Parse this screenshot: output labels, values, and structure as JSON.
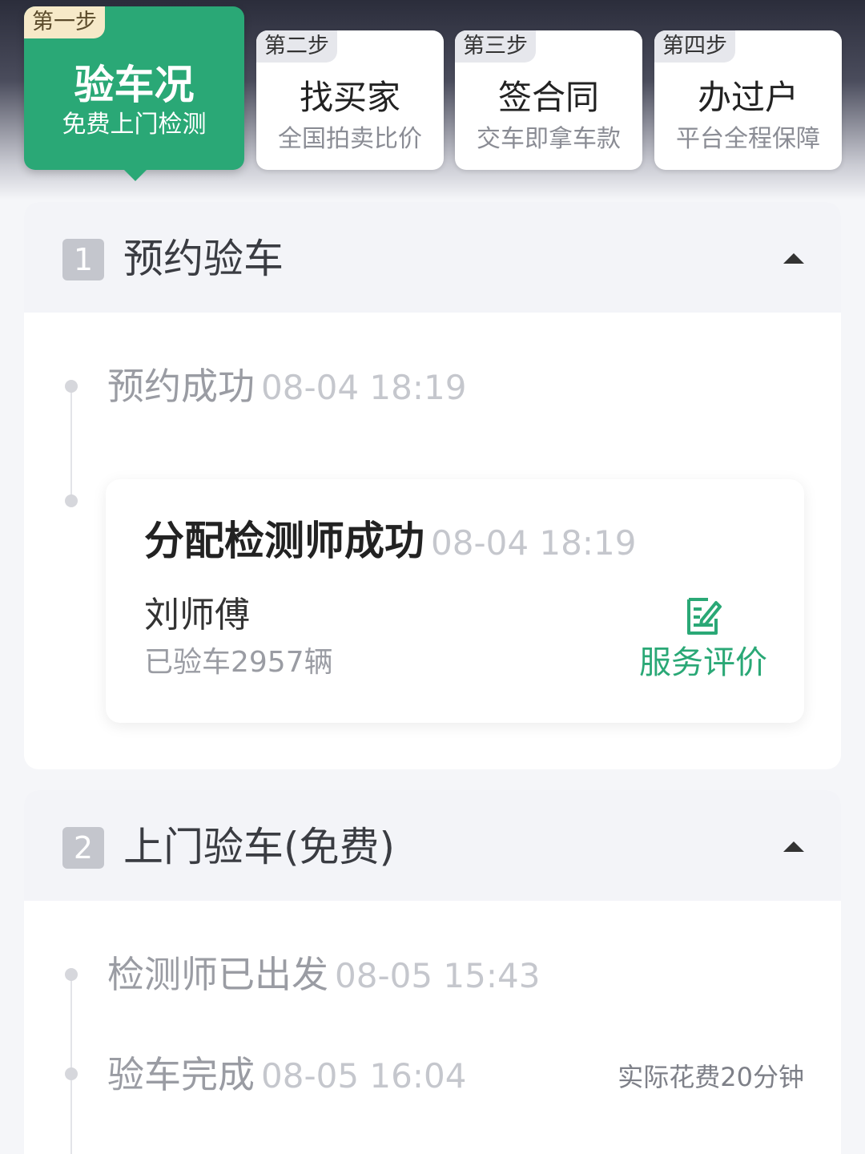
{
  "steps": [
    {
      "tag": "第一步",
      "title": "验车况",
      "sub": "免费上门检测",
      "active": true
    },
    {
      "tag": "第二步",
      "title": "找买家",
      "sub": "全国拍卖比价",
      "active": false
    },
    {
      "tag": "第三步",
      "title": "签合同",
      "sub": "交车即拿车款",
      "active": false
    },
    {
      "tag": "第四步",
      "title": "办过户",
      "sub": "平台全程保障",
      "active": false
    }
  ],
  "section1": {
    "number": "1",
    "title": "预约验车",
    "events": [
      {
        "label": "预约成功",
        "time": "08-04 18:19"
      }
    ],
    "inspector": {
      "title": "分配检测师成功",
      "time": "08-04 18:19",
      "name": "刘师傅",
      "count": "已验车2957辆",
      "rate_label": "服务评价"
    }
  },
  "section2": {
    "number": "2",
    "title": "上门验车(免费)",
    "events": [
      {
        "label": "检测师已出发",
        "time": "08-05 15:43"
      },
      {
        "label": "验车完成",
        "time": "08-05 16:04",
        "note": "实际花费20分钟"
      }
    ]
  },
  "colors": {
    "accent": "#2aa876",
    "muted": "#9a9ca3",
    "header_dark": "#2b2d3b"
  }
}
